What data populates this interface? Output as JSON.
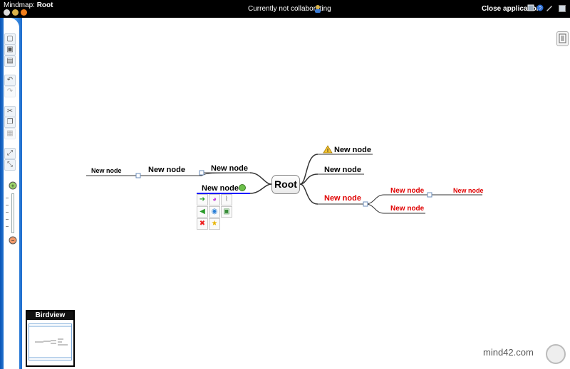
{
  "topbar": {
    "title_prefix": "Mindmap:",
    "title_name": "Root",
    "collab_status": "Currently not collaborating",
    "close_app": "Close application",
    "icons": [
      "help-icon",
      "user-icon",
      "rss-icon",
      "collaborate-icon",
      "settings-icon",
      "info-icon",
      "wrench-icon",
      "window-icon"
    ]
  },
  "toolbar": {
    "tools": [
      "open-icon",
      "save-icon",
      "save-as-icon",
      "undo-icon",
      "redo-icon",
      "cut-icon",
      "copy-icon",
      "paste-icon",
      "expand-icon",
      "collapse-icon"
    ],
    "zoom_in": "zoom-in-icon",
    "zoom_out": "zoom-out-icon"
  },
  "map": {
    "root": "Root",
    "left_nodes": {
      "far": "New node",
      "mid": "New node",
      "upper": "New node",
      "selected": "New node"
    },
    "right_nodes": {
      "warning": "New node",
      "plain": "New node",
      "red_parent": "New node",
      "red_child_1": "New node",
      "red_child_2": "New node",
      "red_grandchild": "New node"
    },
    "colors": {
      "red": "#e00000",
      "selection": "#1a1aff",
      "line": "#333333"
    }
  },
  "palette": {
    "icons": [
      "arrow-right-icon",
      "color-wheel-icon",
      "attachment-icon",
      "share-icon",
      "link-icon",
      "image-icon",
      "delete-icon",
      "star-icon"
    ]
  },
  "birdview": {
    "title": "Birdview"
  },
  "branding": {
    "logo": "mind42.com"
  }
}
